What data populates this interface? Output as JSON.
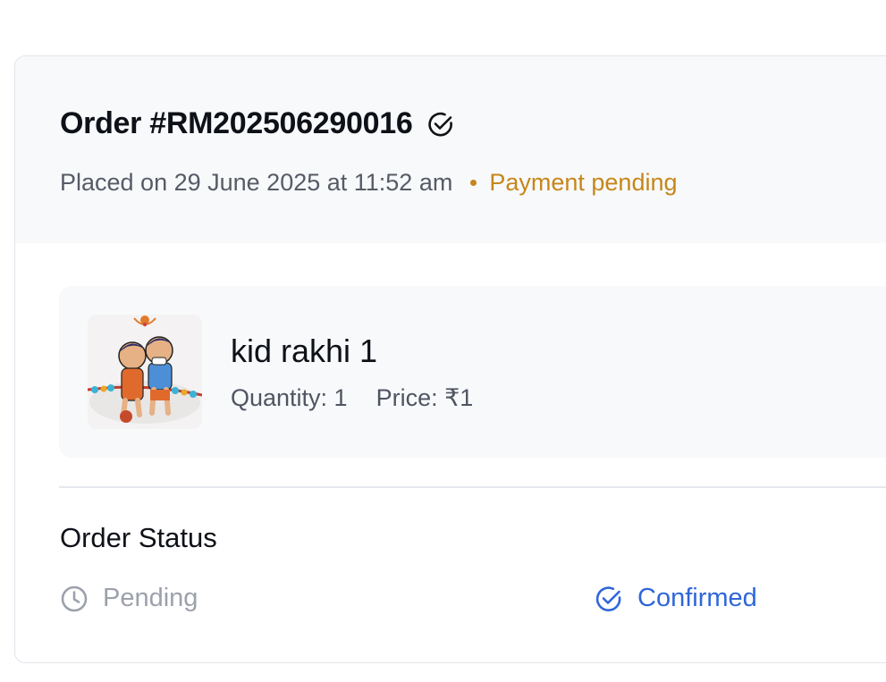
{
  "order": {
    "title": "Order #RM202506290016",
    "title_icon": "check-circle-icon",
    "placed_text": "Placed on 29 June 2025 at 11:52 am",
    "payment_status": "Payment pending"
  },
  "item": {
    "name": "kid rakhi 1",
    "quantity_text": "Quantity: 1",
    "price_text": "Price: ₹1",
    "image_alt": "kid rakhi 1"
  },
  "status": {
    "heading": "Order Status",
    "steps": [
      {
        "label": "Pending",
        "icon": "clock-icon",
        "state": "inactive"
      },
      {
        "label": "Confirmed",
        "icon": "check-circle-icon",
        "state": "active"
      }
    ]
  },
  "colors": {
    "payment_pending": "#c6861a",
    "active_step": "#2f66d8",
    "inactive_step": "#9ca1ab"
  }
}
